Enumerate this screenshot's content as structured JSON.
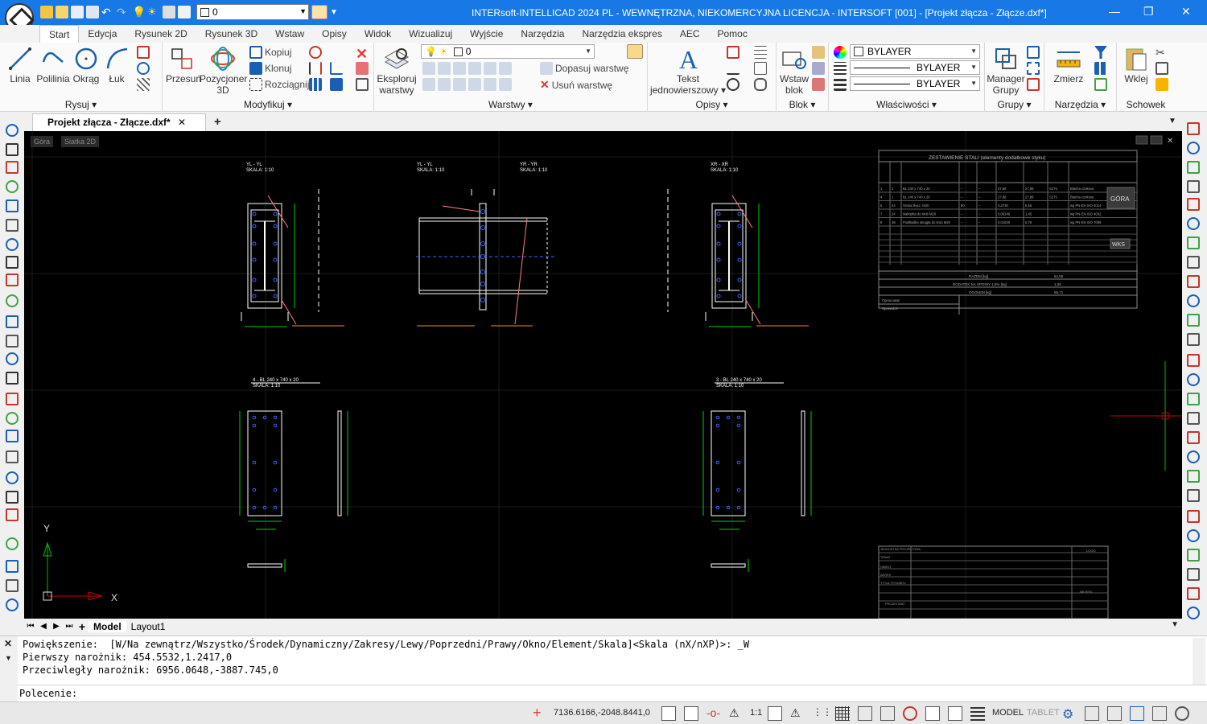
{
  "window": {
    "title": "INTERsoft-INTELLICAD 2024 PL - WEWNĘTRZNA, NIEKOMERCYJNA LICENCJA - INTERSOFT [001] - [Projekt złącza - Złącze.dxf*]",
    "minimize": "—",
    "restore": "❐",
    "close": "✕"
  },
  "quick_access": {
    "layer_value": "0"
  },
  "ribbon_tabs": [
    "Start",
    "Edycja",
    "Rysunek 2D",
    "Rysunek 3D",
    "Wstaw",
    "Opisy",
    "Widok",
    "Wizualizuj",
    "Wyjście",
    "Narzędzia",
    "Narzędzia ekspres",
    "AEC",
    "Pomoc"
  ],
  "panels": {
    "rysuj": {
      "label": "Rysuj ▾",
      "linia": "Linia",
      "polilinia": "Polilinia",
      "okrag": "Okrąg",
      "luk": "Łuk"
    },
    "modyfikuj": {
      "label": "Modyfikuj ▾",
      "przesun": "Przesuń",
      "pozycjoner": "Pozycjoner 3D",
      "kopiuj": "Kopiuj",
      "klonuj": "Klonuj",
      "rozciagnij": "Rozciągnij"
    },
    "warstwy": {
      "label": "Warstwy ▾",
      "eksploruj": "Eksploruj warstwy",
      "layer_value": "0",
      "dopasuj": "Dopasuj warstwę",
      "usun": "Usuń warstwę"
    },
    "opisy": {
      "label": "Opisy ▾",
      "tekst": "Tekst jednowierszowy ▾"
    },
    "blok": {
      "label": "Blok ▾",
      "wstaw": "Wstaw blok"
    },
    "wlasciwosci": {
      "label": "Właściwości ▾",
      "color": "BYLAYER",
      "linetype": "BYLAYER",
      "lineweight": "BYLAYER"
    },
    "grupy": {
      "label": "Grupy ▾",
      "manager": "Manager Grupy"
    },
    "narzedzia": {
      "label": "Narzędzia ▾",
      "zmierz": "Zmierz"
    },
    "schowek": {
      "label": "Schowek",
      "wklej": "Wklej"
    }
  },
  "document_tab": {
    "label": "Projekt złącza - Złącze.dxf*",
    "close": "✕",
    "add": "+"
  },
  "viewport": {
    "view_label": "Góra",
    "grid_label": "Siatka 2D",
    "cube_label": "GÓRA",
    "wcs_label": "WKS",
    "axis_x": "X",
    "axis_y": "Y"
  },
  "drawing_labels": {
    "sec1": "YL - YL",
    "sec1_scale": "SKALA: 1:10",
    "sec2": "YL - YL",
    "sec2_scale": "SKALA: 1:10",
    "sec3": "YR - YR",
    "sec3_scale": "SKALA: 1:10",
    "sec4": "XR - XR",
    "sec4_scale": "SKALA: 1:10",
    "plate4": "4 - BL 240 x 740 x 20",
    "plate4_scale": "SKALA: 1:10",
    "plate3": "3 - BL 240 x 740 x 20",
    "plate3_scale": "SKALA: 1:10",
    "table_title": "ZESTAWIENIE STALI (elementy dodatkowe styku)",
    "table_rows": [
      [
        "1",
        "1",
        "BL 240 x 740 x 20",
        "–",
        "–",
        "27,88",
        "27,88",
        "S275",
        "Blacha czołowa"
      ],
      [
        "4",
        "1",
        "BL 240 x 740 x 20",
        "–",
        "–",
        "27,88",
        "27,88",
        "S275",
        "Blacha czołowa"
      ],
      [
        "5",
        "24",
        "Śruba złącz. M20",
        "80",
        "–",
        "0,2730",
        "6,55",
        "",
        "wg PN-EN ISO 4014"
      ],
      [
        "7",
        "24",
        "Nakrętka do śrub M20",
        "–",
        "–",
        "0,06246",
        "1,45",
        "",
        "wg PN-EN ISO 4032"
      ],
      [
        "8",
        "48",
        "Podkładka okrągła do śrub M20",
        "–",
        "–",
        "0,01630",
        "0,78",
        "",
        "wg PN-EN ISO 7089"
      ]
    ],
    "sum1": "RAZEM [kg]",
    "sum2": "DODATEK NA SPOINY 1,5% [kg]",
    "sum3": "OGÓŁEM [kg]",
    "sum1_val": "64,55",
    "sum2_val": "1,36",
    "sum3_val": "65,71",
    "opracowal": "Opracował",
    "sprawdzil": "Sprawdził",
    "tb_jednostka": "JEDNOSTKA PROJEKTOWA",
    "tb_temat": "TEMAT",
    "tb_obiekt": "OBIEKT",
    "tb_adres": "ADRES",
    "tb_tytul": "TYTUŁ RYSUNKU",
    "tb_projektant": "PROJEKTANT",
    "tb_logo": "LOGO",
    "tb_nr": "NR RYS."
  },
  "layout_tabs": [
    "Model",
    "Layout1"
  ],
  "command": {
    "line1": "Powiększenie:  [W/Na zewnątrz/Wszystko/Środek/Dynamiczny/Zakresy/Lewy/Poprzedni/Prawy/Okno/Element/Skala]<Skala (nX/nXP)>: _W",
    "line2": "Pierwszy narożnik: 454.5532,1.2417,0",
    "line3": "Przeciwległy narożnik: 6956.0648,-3887.745,0",
    "prompt": "Polecenie:"
  },
  "status": {
    "coords": "7136.6166,-2048.8441,0",
    "scale": "1:1",
    "model": "MODEL",
    "tablet": "TABLET"
  },
  "colors": {
    "accent": "#1778e6",
    "canvas": "#000000",
    "geometry": "#ffffff",
    "dimension": "#00d000",
    "annotation": "#ff8c00",
    "bolt": "#4060ff",
    "leader": "#ff8080"
  }
}
